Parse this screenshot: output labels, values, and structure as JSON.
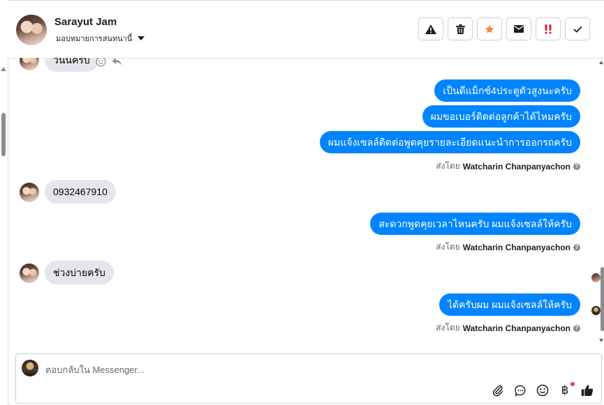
{
  "header": {
    "contact_name": "Sarayut Jam",
    "assign_label": "มอบหมายการสนทนานี้",
    "actions": [
      {
        "name": "mark-spam-button",
        "icon": "warning-icon"
      },
      {
        "name": "delete-button",
        "icon": "trash-icon"
      },
      {
        "name": "star-button",
        "icon": "star-icon"
      },
      {
        "name": "mark-unread-button",
        "icon": "envelope-icon"
      },
      {
        "name": "follow-up-button",
        "icon": "exclamation-icon"
      },
      {
        "name": "mark-done-button",
        "icon": "check-icon"
      }
    ]
  },
  "messages": {
    "m1_in": "วันนี้ครับ",
    "m2_out": "เป็นดีแม็กซ์4ประตูตัวสูงนะครับ",
    "m3_out": "ผมขอเบอร์ติดต่อลูกค้าได้ไหมครับ",
    "m4_out": "ผมแจ้งเซลล์ติดต่อพูดคุยรายละเอียดแนะนำการออกรถครับ",
    "m5_in": "0932467910",
    "m6_out": "สะดวกพูดคุยเวลาไหนครับ ผมแจ้งเซลล์ให้ครับ",
    "m7_in": "ช่วงบ่ายครับ",
    "m8_out": "ได้ครับผม ผมแจ้งเซลล์ให้ครับ"
  },
  "sent_by": {
    "prefix": "ส่งโดย",
    "agent": "Watcharin Chanpanyachon"
  },
  "composer": {
    "placeholder": "ตอบกลับใน Messenger...",
    "currency_symbol": "฿"
  },
  "colors": {
    "outgoing_bubble": "#0084ff",
    "incoming_bubble": "#e4e6eb",
    "star": "#f5833b",
    "exclamation": "#e41e3f"
  }
}
